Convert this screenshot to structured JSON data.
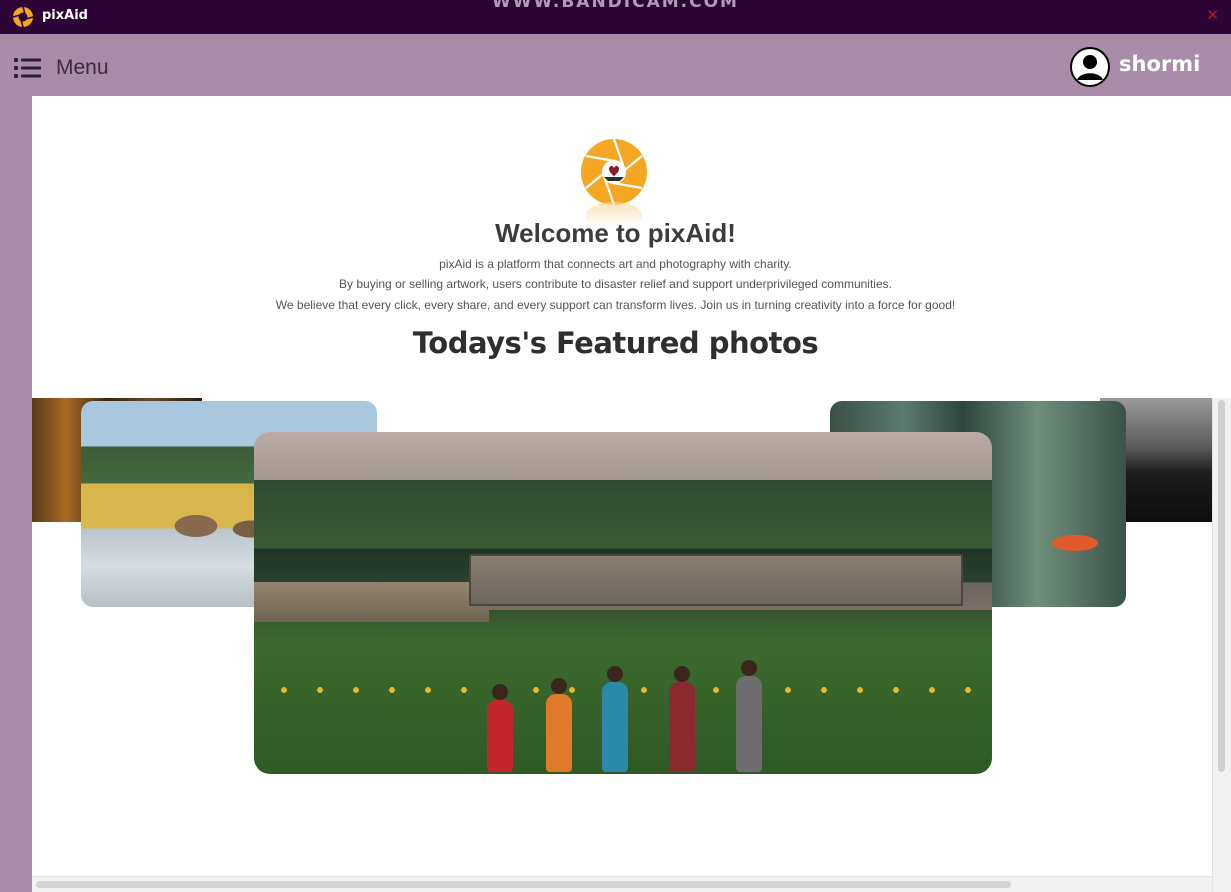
{
  "titlebar": {
    "app_title": "pixAid",
    "watermark": "WWW.BANDICAM.COM",
    "close_icon": "close-icon"
  },
  "header": {
    "menu_label": "Menu",
    "menu_icon": "list-icon",
    "user_icon": "user-avatar-icon",
    "username": "shormi"
  },
  "main": {
    "logo_icon": "camera-aperture-heart-icon",
    "welcome_title": "Welcome to pixAid!",
    "description": [
      "pixAid is a platform that connects art and photography with charity.",
      "By buying or selling artwork, users contribute to disaster relief and support underprivileged communities.",
      "We believe that every click, every share, and every support can transform lives. Join us in turning creativity into a force for good!"
    ],
    "featured_title": "Todays's Featured photos"
  },
  "colors": {
    "titlebar_bg": "#2c0436",
    "header_bg": "#a98ca8",
    "logo_orange": "#f5a623",
    "close_red": "#c21818"
  }
}
